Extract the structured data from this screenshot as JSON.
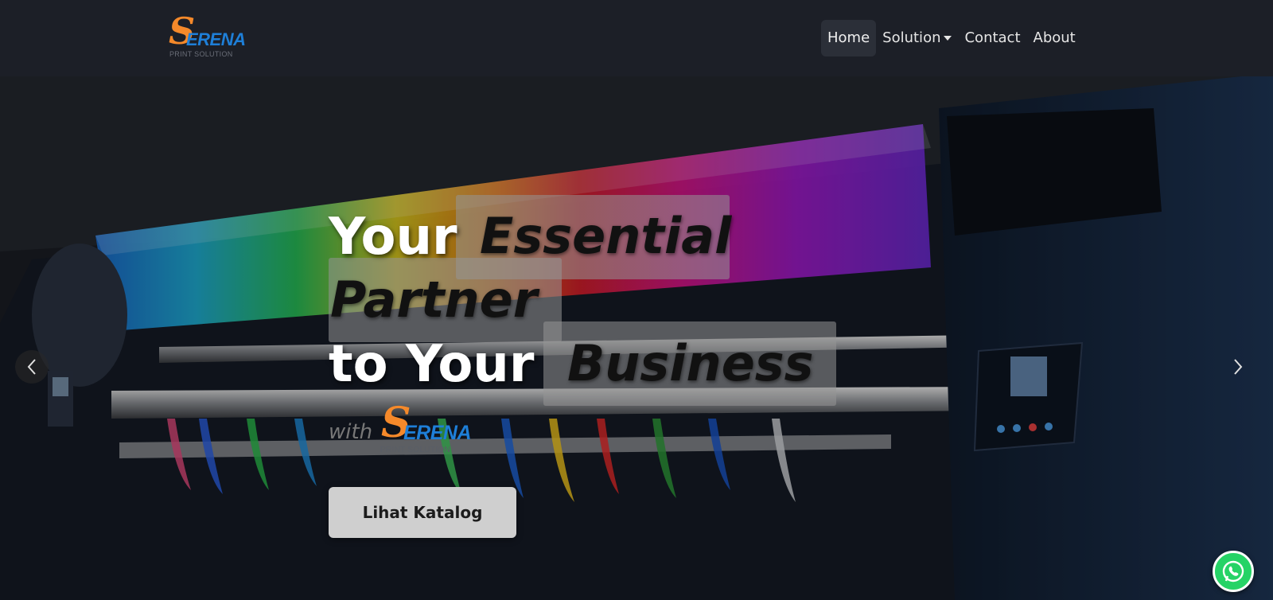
{
  "brand": {
    "logo_letter": "S",
    "logo_word": "ERENA",
    "logo_sub": "PRINT SOLUTION"
  },
  "nav": {
    "items": [
      {
        "label": "Home",
        "active": true
      },
      {
        "label": "Solution",
        "dropdown": true
      },
      {
        "label": "Contact"
      },
      {
        "label": "About"
      }
    ]
  },
  "hero": {
    "line1_plain": "Your",
    "line1_italic": "Essential",
    "line2_italic": "Partner",
    "line3_plain": "to Your",
    "line3_italic": "Business",
    "with_text": "with",
    "cta_label": "Lihat Katalog"
  },
  "icons": {
    "prev": "chevron-left-icon",
    "next": "chevron-right-icon",
    "whatsapp": "whatsapp-icon"
  },
  "colors": {
    "navbar_bg": "#1c1f27",
    "logo_orange": "#f5892a",
    "logo_blue": "#1e7fd8",
    "cta_bg": "#cfcfcf",
    "whatsapp_green": "#25d366"
  }
}
